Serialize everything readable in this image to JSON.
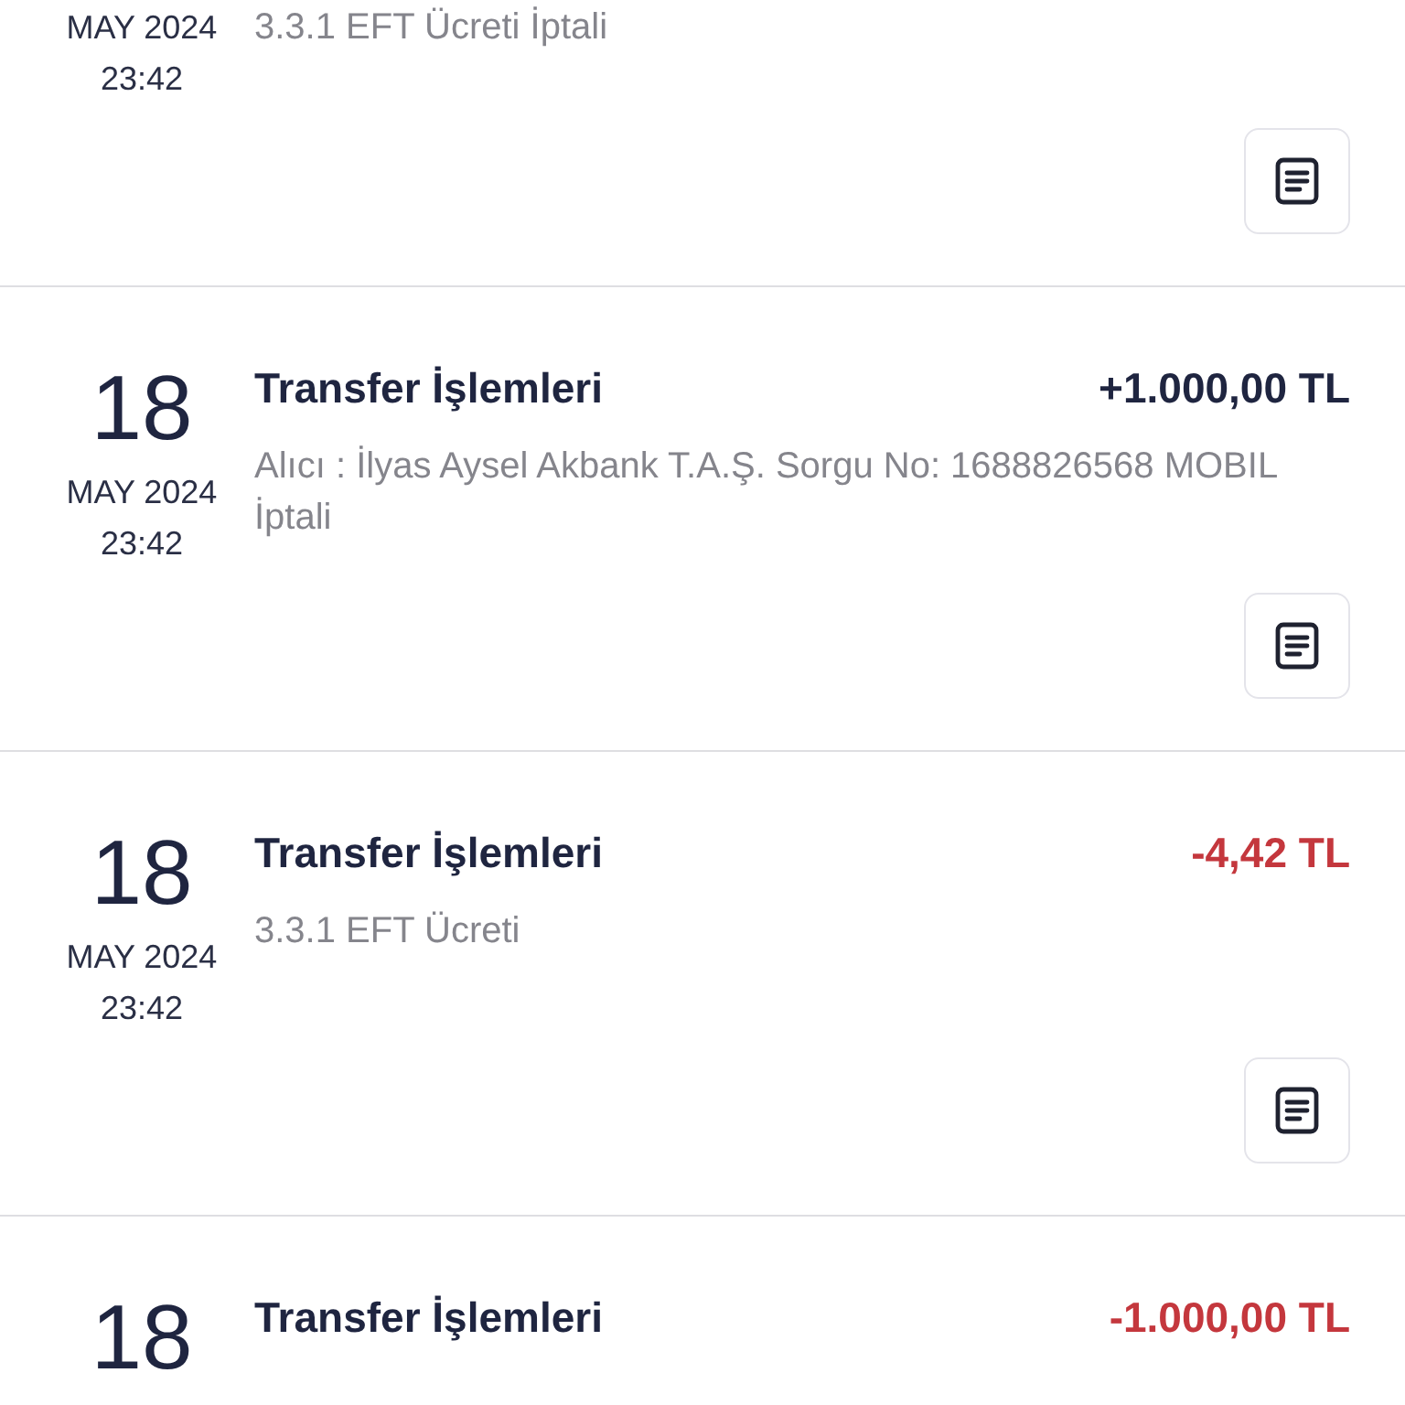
{
  "transactions": [
    {
      "month": "MAY 2024",
      "time": "23:42",
      "description": "3.3.1 EFT Ücreti İptali"
    },
    {
      "day": "18",
      "month": "MAY 2024",
      "time": "23:42",
      "title": "Transfer İşlemleri",
      "amount": "+1.000,00 TL",
      "kind": "credit",
      "description": "Alıcı : İlyas Aysel Akbank T.A.Ş. Sorgu No: 1688826568 MOBIL İptali"
    },
    {
      "day": "18",
      "month": "MAY 2024",
      "time": "23:42",
      "title": "Transfer İşlemleri",
      "amount": "-4,42 TL",
      "kind": "debit",
      "description": "3.3.1 EFT Ücreti"
    },
    {
      "day": "18",
      "title": "Transfer İşlemleri",
      "amount": "-1.000,00 TL",
      "kind": "debit"
    }
  ]
}
